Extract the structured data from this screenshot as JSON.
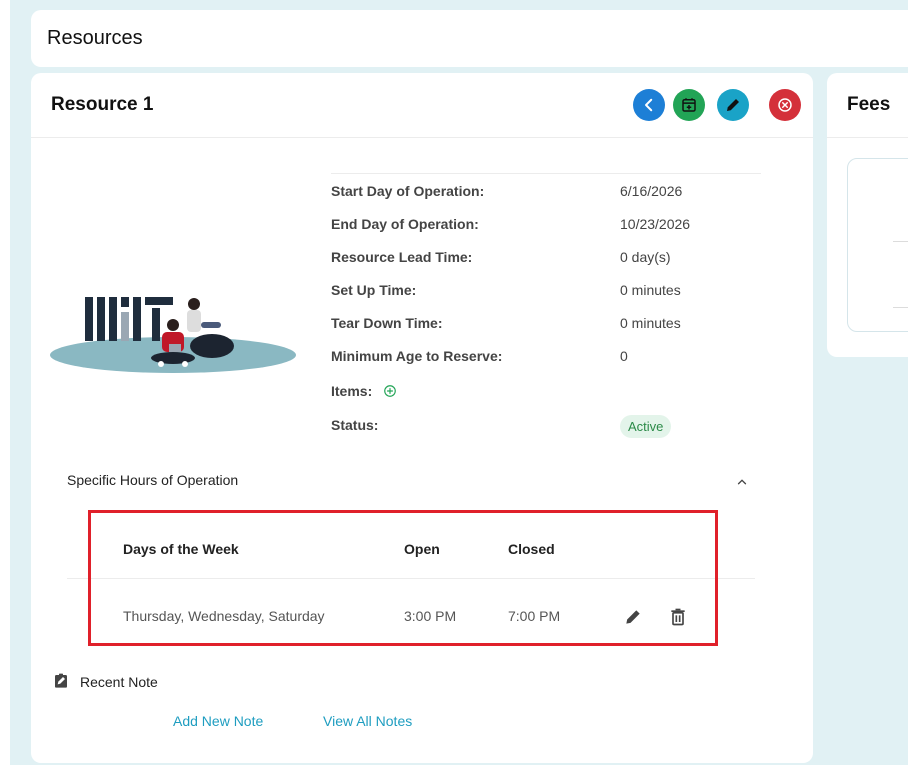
{
  "header": {
    "title": "Resources"
  },
  "resource": {
    "title": "Resource 1",
    "details": [
      {
        "label": "Start Day of Operation:",
        "value": "6/16/2026"
      },
      {
        "label": "End Day of Operation:",
        "value": "10/23/2026"
      },
      {
        "label": "Resource Lead Time:",
        "value": "0 day(s)"
      },
      {
        "label": "Set Up Time:",
        "value": "0 minutes"
      },
      {
        "label": "Tear Down Time:",
        "value": "0 minutes"
      },
      {
        "label": "Minimum Age to Reserve:",
        "value": "0"
      },
      {
        "label": "Items:",
        "value": ""
      },
      {
        "label": "Status:",
        "value": ""
      }
    ],
    "status": "Active"
  },
  "hours": {
    "section_title": "Specific Hours of Operation",
    "columns": [
      "Days of the Week",
      "Open",
      "Closed"
    ],
    "rows": [
      {
        "days": "Thursday, Wednesday, Saturday",
        "open": "3:00 PM",
        "closed": "7:00 PM"
      }
    ]
  },
  "notes": {
    "title": "Recent Note",
    "add_label": "Add New Note",
    "view_label": "View All Notes"
  },
  "fees": {
    "title": "Fees"
  },
  "icons": {
    "back": "chevron-left-icon",
    "calendar": "calendar-add-icon",
    "edit": "pencil-icon",
    "close": "close-circle-icon",
    "add_item": "plus-circle-icon",
    "collapse": "chevron-up-icon",
    "row_edit": "pencil-icon",
    "row_delete": "trash-icon",
    "note": "clipboard-edit-icon"
  },
  "colors": {
    "back": "#1d7fd6",
    "calendar": "#22a456",
    "edit": "#1aa3c7",
    "close": "#d4303a",
    "link": "#1e9dc0",
    "status_bg": "#e3f4ea",
    "status_fg": "#2b8a48",
    "highlight": "#e0202a"
  }
}
